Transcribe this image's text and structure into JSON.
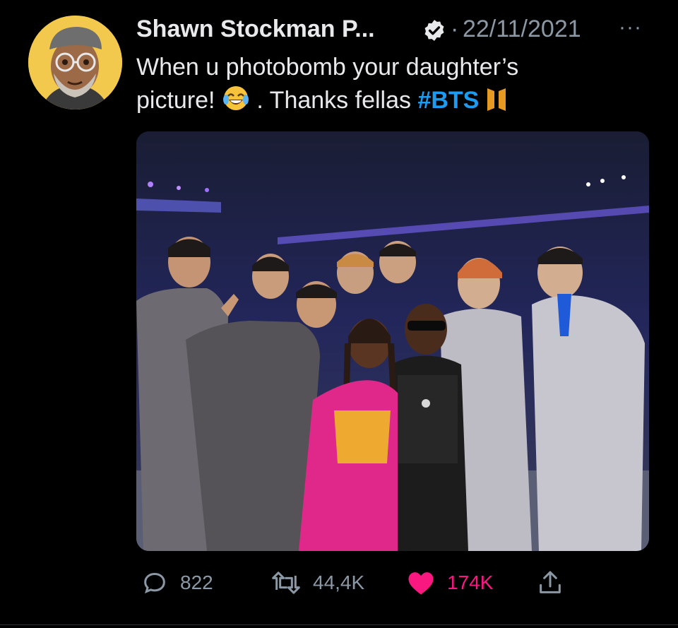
{
  "tweet": {
    "author_name": "Shawn Stockman P...",
    "separator": "·",
    "date": "22/11/2021",
    "more_label": "···",
    "text_line1": "When u photobomb your daughter’s",
    "text_line2_a": "picture!",
    "text_emoji": "😂",
    "text_line2_b": ". Thanks fellas",
    "hashtag": "#BTS",
    "hashtag_emoji": "BTS-logo"
  },
  "icons": {
    "avatar": "avatar-image",
    "verified": "verified-badge-icon",
    "reply": "reply-icon",
    "retweet": "retweet-icon",
    "like": "heart-icon",
    "share": "share-icon"
  },
  "actions": {
    "replies": "822",
    "retweets": "44,4K",
    "likes": "174K"
  },
  "colors": {
    "background": "#000000",
    "text": "#e7e9ea",
    "muted": "#8b98a5",
    "link": "#1d9bf0",
    "like": "#f91880",
    "avatar_bg": "#f2c94c"
  }
}
